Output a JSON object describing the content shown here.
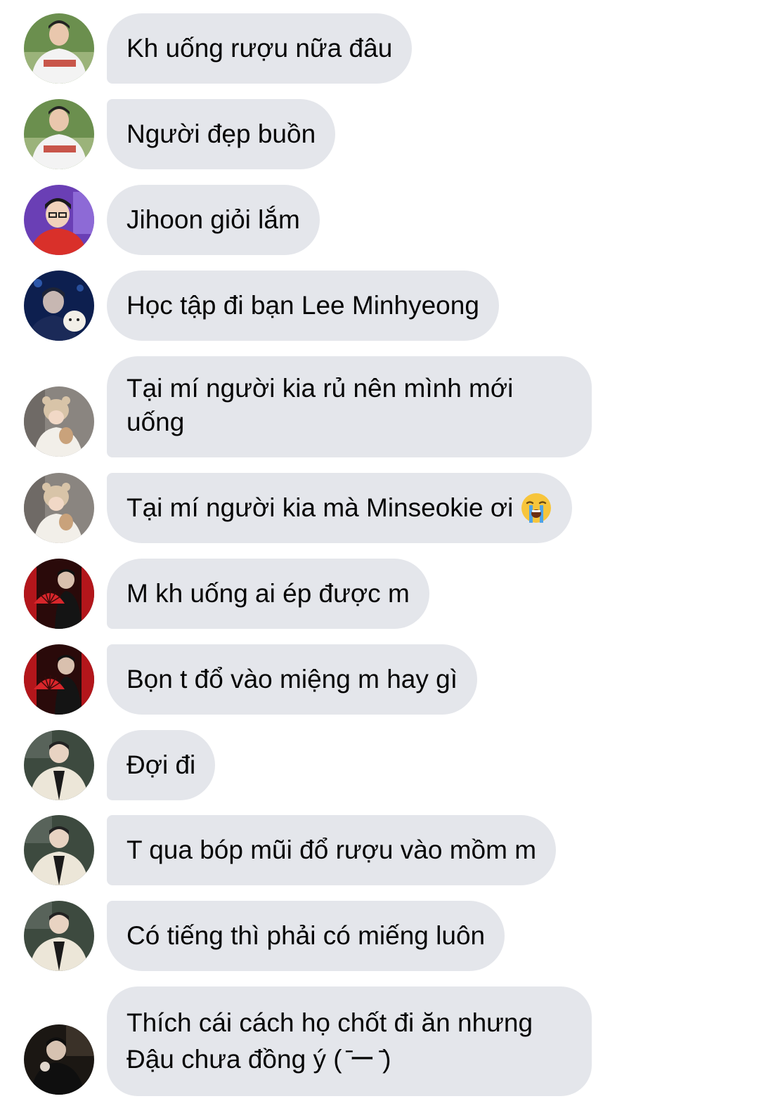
{
  "messages": [
    {
      "avatar": "baseball-jersey-avatar",
      "text": "Kh uống rượu nữa đâu"
    },
    {
      "avatar": "baseball-jersey-avatar",
      "text": "Người đẹp buồn"
    },
    {
      "avatar": "purple-background-glasses-avatar",
      "text": "Jihoon giỏi lắm"
    },
    {
      "avatar": "blue-night-puppy-avatar",
      "text": "Học tập đi bạn Lee Minhyeong"
    },
    {
      "avatar": "bear-hat-avatar",
      "text": "Tại mí người kia rủ nên mình mới uống"
    },
    {
      "avatar": "bear-hat-avatar",
      "text": "Tại mí người kia mà Minseokie ơi",
      "emoji": "loudly-crying-face-icon"
    },
    {
      "avatar": "red-fan-avatar",
      "text": "M kh uống ai ép được m"
    },
    {
      "avatar": "red-fan-avatar",
      "text": "Bọn t đổ vào miệng m hay gì"
    },
    {
      "avatar": "fleece-jacket-avatar",
      "text": "Đợi đi"
    },
    {
      "avatar": "fleece-jacket-avatar",
      "text": "T qua bóp mũi đổ rượu vào mồm m"
    },
    {
      "avatar": "fleece-jacket-avatar",
      "text": "Có tiếng thì phải có miếng luôn"
    },
    {
      "avatar": "dark-room-avatar",
      "text": "Thích cái cách họ chốt đi ăn nhưng Đậu chưa đồng ý ( ̄ー ̄)"
    }
  ],
  "colors": {
    "bubble_bg": "#e4e6eb",
    "text": "#050505",
    "background": "#ffffff"
  }
}
